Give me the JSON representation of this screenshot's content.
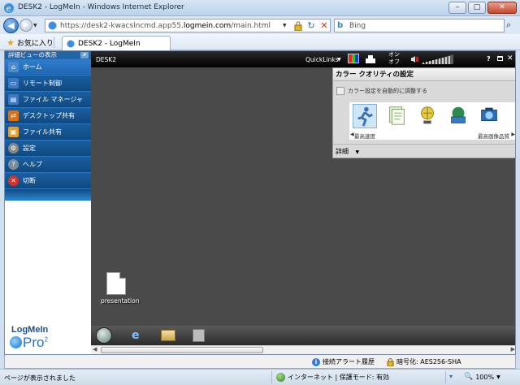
{
  "window": {
    "title": "DESK2 - LogMeIn - Windows Internet Explorer",
    "min_icon": "minimize-icon",
    "max_icon": "maximize-icon",
    "close_icon": "close-icon"
  },
  "address": {
    "url_prefix": "https://desk2-kwacslncmd.app55.",
    "url_domain": "logmein.com",
    "url_suffix": "/main.html",
    "search_placeholder": "Bing"
  },
  "favorites": {
    "favorites_label": "お気に入り",
    "tab_title": "DESK2 - LogMeIn"
  },
  "sidebar": {
    "detail_view_label": "詳細ビューの表示",
    "items": [
      {
        "label": "ホーム",
        "icon": "home-icon",
        "color": "#4a8ad0"
      },
      {
        "label": "リモート制御",
        "icon": "remote-control-icon",
        "color": "#3b78c2"
      },
      {
        "label": "ファイル マネージャ",
        "icon": "file-manager-icon",
        "color": "#3b78c2"
      },
      {
        "label": "デスクトップ共有",
        "icon": "desktop-share-icon",
        "color": "#d2731f"
      },
      {
        "label": "ファイル共有",
        "icon": "file-share-icon",
        "color": "#e0a13a"
      },
      {
        "label": "設定",
        "icon": "settings-icon",
        "color": "#888888"
      },
      {
        "label": "ヘルプ",
        "icon": "help-icon",
        "color": "#7a8ca0"
      },
      {
        "label": "切断",
        "icon": "disconnect-icon",
        "color": "#d0342c"
      }
    ],
    "logo_text": "LogMeIn",
    "logo_pro": "Pro",
    "logo_sup": "2"
  },
  "remote": {
    "computer_name": "DESK2",
    "quicklinks_label": "QuickLinks",
    "onoff_label": "オン\nオフ",
    "desktop_icon_label": "presentation"
  },
  "color_quality": {
    "title": "カラー クオリティの設定",
    "auto_label": "カラー設定を自動的に調整する",
    "left_label": "最高速度",
    "right_label": "最高画像品質",
    "detail_label": "詳細"
  },
  "lmi_status": {
    "alert_label": "接続アラート履歴",
    "encryption_label": "暗号化: AES256-SHA"
  },
  "ie_status": {
    "message": "ページが表示されました",
    "zone_label": "インターネット | 保護モード: 有効",
    "zoom_label": "100%"
  }
}
